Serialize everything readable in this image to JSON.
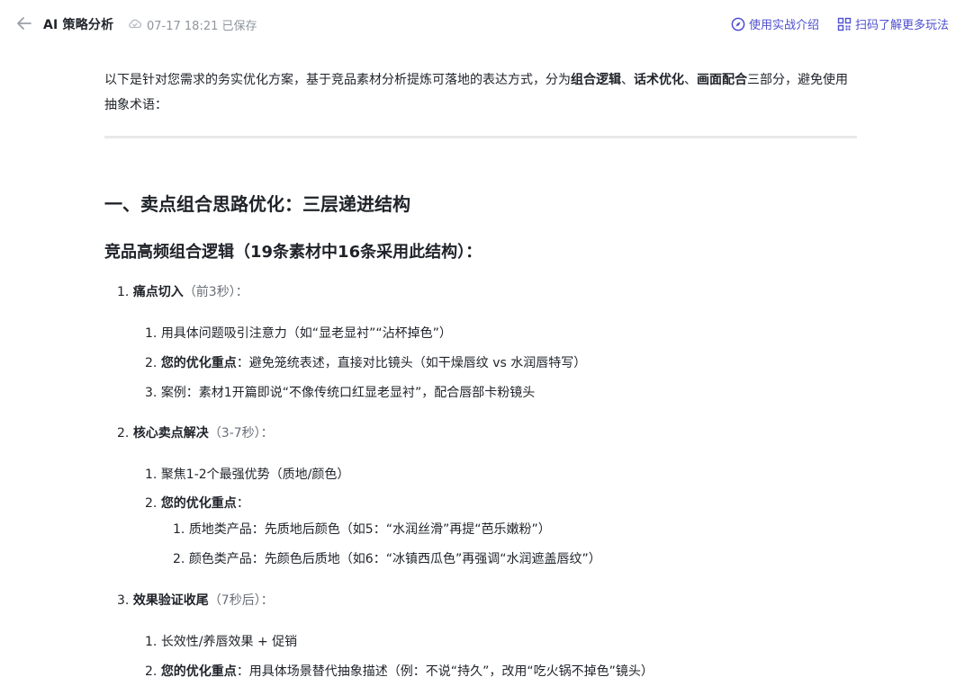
{
  "header": {
    "title": "AI 策略分析",
    "saved_time": "07-17 18:21 已保存",
    "link_intro": "使用实战介绍",
    "link_scan": "扫码了解更多玩法"
  },
  "intro": {
    "text1": "以下是针对您需求的务实优化方案，基于竞品素材分析提炼可落地的表达方式，分为",
    "b1": "组合逻辑",
    "sep1": "、",
    "b2": "话术优化",
    "sep2": "、",
    "b3": "画面配合",
    "text2": "三部分，避免使用抽象术语："
  },
  "section1": {
    "heading": "一、卖点组合思路优化：三层递进结构",
    "subheading": "竞品高频组合逻辑（19条素材中16条采用此结构）：",
    "steps": [
      {
        "num": "1.",
        "title": "痛点切入",
        "time": "（前3秒）：",
        "items": [
          {
            "num": "1.",
            "bold": "",
            "text": "用具体问题吸引注意力（如“显老显衬”“沾杯掉色”）"
          },
          {
            "num": "2.",
            "bold": "您的优化重点",
            "text": "：避免笼统表述，直接对比镜头（如干燥唇纹 vs 水润唇特写）"
          },
          {
            "num": "3.",
            "bold": "",
            "text": "案例：素材1开篇即说“不像传统口红显老显衬”，配合唇部卡粉镜头"
          }
        ]
      },
      {
        "num": "2.",
        "title": "核心卖点解决",
        "time": "（3-7秒）：",
        "items": [
          {
            "num": "1.",
            "bold": "",
            "text": "聚焦1-2个最强优势（质地/颜色）"
          },
          {
            "num": "2.",
            "bold": "您的优化重点",
            "text": "："
          }
        ],
        "subitems": [
          {
            "num": "1.",
            "text": "质地类产品：先质地后颜色（如5：“水润丝滑”再提“芭乐嫩粉”）"
          },
          {
            "num": "2.",
            "text": "颜色类产品：先颜色后质地（如6：“冰镇西瓜色”再强调“水润遮盖唇纹”）"
          }
        ]
      },
      {
        "num": "3.",
        "title": "效果验证收尾",
        "time": "（7秒后）：",
        "items": [
          {
            "num": "1.",
            "bold": "",
            "text": "长效性/养唇效果 + 促销"
          },
          {
            "num": "2.",
            "bold": "您的优化重点",
            "text": "：用具体场景替代抽象描述（例：不说“持久”，改用“吃火锅不掉色”镜头）"
          }
        ]
      }
    ]
  }
}
